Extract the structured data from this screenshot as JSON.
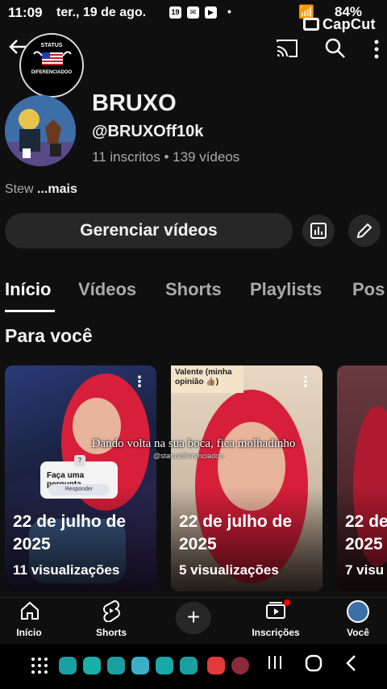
{
  "status_bar": {
    "time": "11:09",
    "date": "ter., 19 de ago.",
    "notif_calendar": "19",
    "battery": "84%",
    "watermark": "CapCut"
  },
  "top_bar": {
    "back_icon": "arrow-left-icon",
    "cast_icon": "cast-icon",
    "search_icon": "search-icon",
    "more_icon": "more-vert-icon",
    "badge_lines": [
      "STATUS",
      "DIFERENCIADOO"
    ]
  },
  "channel": {
    "name": "BRUXO",
    "handle": "@BRUXOff10k",
    "stats": "11 inscritos • 139 vídeos",
    "description": "Stew",
    "more_label": "...mais"
  },
  "actions": {
    "manage_label": "Gerenciar vídeos",
    "analytics_icon": "analytics-icon",
    "edit_icon": "edit-pencil-icon"
  },
  "tabs": [
    "Início",
    "Vídeos",
    "Shorts",
    "Playlists",
    "Pos"
  ],
  "section_title": "Para você",
  "cards": [
    {
      "title": "22 de julho de 2025",
      "views": "11 visualizações"
    },
    {
      "title": "22 de julho de 2025",
      "views": "5 visualizações"
    },
    {
      "title": "22 de",
      "title2": "2025",
      "views": "7 visu"
    }
  ],
  "card_overlays": {
    "caption": "Dando volta na sua boca, fica molhadinho",
    "caption_handle": "@statusdiferenciadoo",
    "question_title": "Faça uma pergunta",
    "question_button": "Responder",
    "label_card": "Valente (minha opinião 👍🏽)"
  },
  "bottom_nav": [
    {
      "label": "Início",
      "icon": "home-icon"
    },
    {
      "label": "Shorts",
      "icon": "shorts-icon"
    },
    {
      "label": "Inscrições",
      "icon": "subscriptions-icon"
    },
    {
      "label": "Você",
      "icon": "avatar-icon"
    }
  ],
  "colors": {
    "background": "#0f0f0f",
    "button_bg": "#272727",
    "secondary_text": "#aaaaaa",
    "accent_red": "#ff0000"
  }
}
